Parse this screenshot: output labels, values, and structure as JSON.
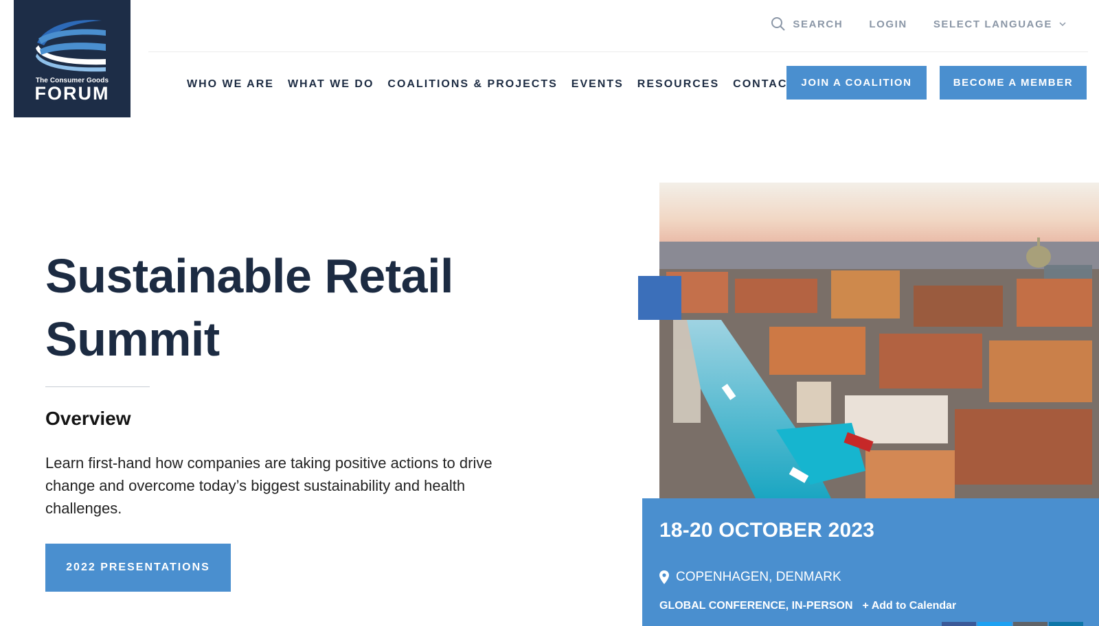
{
  "logo": {
    "tagline": "The Consumer Goods",
    "name": "FORUM"
  },
  "utility": {
    "search_label": "SEARCH",
    "login_label": "LOGIN",
    "language_label": "SELECT LANGUAGE"
  },
  "nav": {
    "items": [
      {
        "label": "WHO WE ARE"
      },
      {
        "label": "WHAT WE DO"
      },
      {
        "label": "COALITIONS & PROJECTS"
      },
      {
        "label": "EVENTS"
      },
      {
        "label": "RESOURCES"
      },
      {
        "label": "CONTACT"
      }
    ],
    "join_label": "JOIN A COALITION",
    "member_label": "BECOME A MEMBER"
  },
  "hero": {
    "title_line1": "Sustainable Retail",
    "title_line2": "Summit",
    "overview_heading": "Overview",
    "description": "Learn first-hand how companies are taking positive actions to drive change and overcome today’s biggest sustainability and health challenges.",
    "button_label": "2022 PRESENTATIONS"
  },
  "event": {
    "date": "18-20 OCTOBER 2023",
    "location": "COPENHAGEN, DENMARK",
    "type": "GLOBAL CONFERENCE, IN-PERSON",
    "calendar_label": "+ Add to Calendar"
  },
  "colors": {
    "navy": "#1d2d47",
    "accent_blue": "#4a8fcf",
    "square_blue": "#3b6fba",
    "muted_text": "#8a96a6"
  },
  "icons": {
    "search": "search-icon",
    "chevron": "chevron-down-icon",
    "pin": "map-pin-icon"
  }
}
